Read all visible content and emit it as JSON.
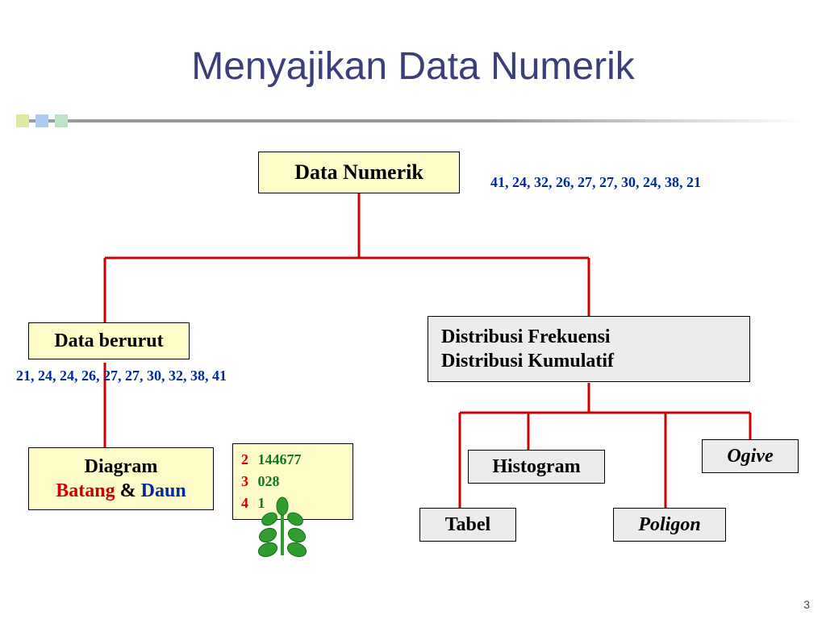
{
  "title": "Menyajikan Data Numerik",
  "root_box": "Data Numerik",
  "raw_data_label": "41, 24, 32, 26, 27, 27, 30, 24, 38, 21",
  "sorted_box": "Data berurut",
  "sorted_data_label": "21, 24, 24, 26, 27, 27, 30, 32, 38, 41",
  "stemleaf_box": {
    "line1": "Diagram",
    "line2a": "Batang",
    "line2amp": " & ",
    "line2b": "Daun"
  },
  "stemleaf_table": {
    "r1_stem": "2",
    "r1_leaf": "144677",
    "r2_stem": "3",
    "r2_leaf": "028",
    "r3_stem": "4",
    "r3_leaf": "1"
  },
  "dist_box": {
    "l1": "Distribusi Frekuensi",
    "l2": "Distribusi Kumulatif"
  },
  "hist_box": "Histogram",
  "ogive_box": "Ogive",
  "tabel_box": "Tabel",
  "poligon_box": "Poligon",
  "page_number": "3"
}
